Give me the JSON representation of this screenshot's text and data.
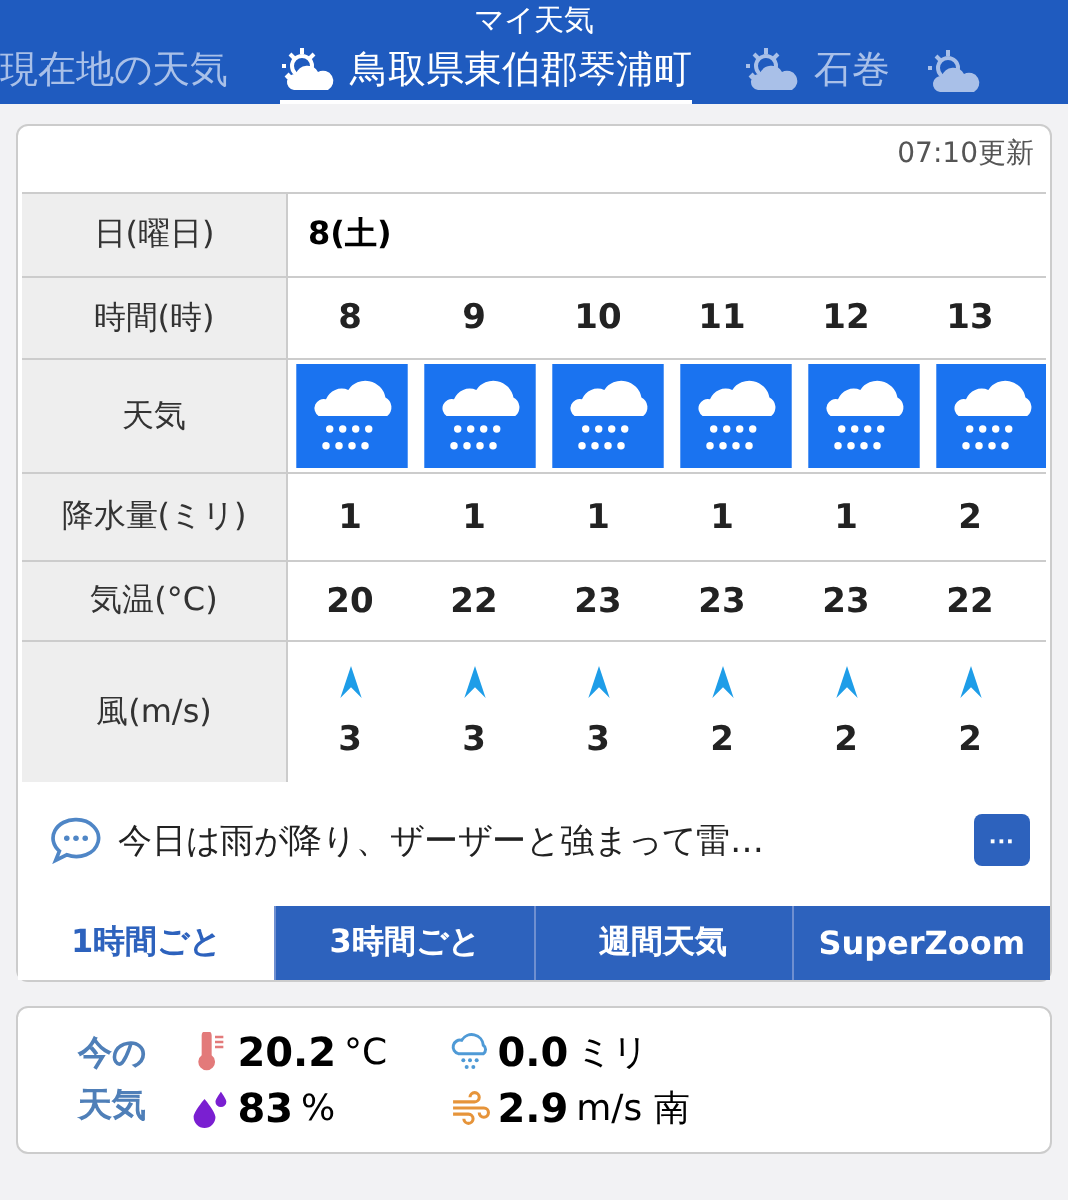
{
  "header": {
    "title": "マイ天気"
  },
  "location_tabs": [
    {
      "label": "現在地の天気",
      "icon": false,
      "selected": false
    },
    {
      "label": "鳥取県東伯郡琴浦町",
      "icon": true,
      "selected": true
    },
    {
      "label": "石巻",
      "icon": true,
      "selected": false
    }
  ],
  "updated": "07:10更新",
  "table": {
    "day_label": "日(曜日)",
    "day": "8(土)",
    "hour_label": "時間(時)",
    "weather_label": "天気",
    "precip_label": "降水量(ミリ)",
    "temp_label": "気温(°C)",
    "wind_label": "風(m/s)",
    "columns": [
      {
        "hour": "8",
        "kind": "rain",
        "precip": "1",
        "temp": "20",
        "wind": "3"
      },
      {
        "hour": "9",
        "kind": "rain",
        "precip": "1",
        "temp": "22",
        "wind": "3"
      },
      {
        "hour": "10",
        "kind": "rain",
        "precip": "1",
        "temp": "23",
        "wind": "3"
      },
      {
        "hour": "11",
        "kind": "rain",
        "precip": "1",
        "temp": "23",
        "wind": "2"
      },
      {
        "hour": "12",
        "kind": "rain",
        "precip": "1",
        "temp": "23",
        "wind": "2"
      },
      {
        "hour": "13",
        "kind": "rain",
        "precip": "2",
        "temp": "22",
        "wind": "2"
      }
    ]
  },
  "comment": "今日は雨が降り、ザーザーと強まって雷…",
  "more_button": "···",
  "range_tabs": [
    {
      "label": "1時間ごと",
      "selected": true
    },
    {
      "label": "3時間ごと",
      "selected": false
    },
    {
      "label": "週間天気",
      "selected": false
    },
    {
      "label": "SuperZoom",
      "selected": false
    }
  ],
  "now": {
    "label": "今の天気",
    "temp": {
      "value": "20.2",
      "unit": "°C"
    },
    "rain": {
      "value": "0.0",
      "unit": "ミリ"
    },
    "humidity": {
      "value": "83",
      "unit": "%"
    },
    "wind": {
      "value": "2.9",
      "unit": "m/s 南"
    }
  }
}
